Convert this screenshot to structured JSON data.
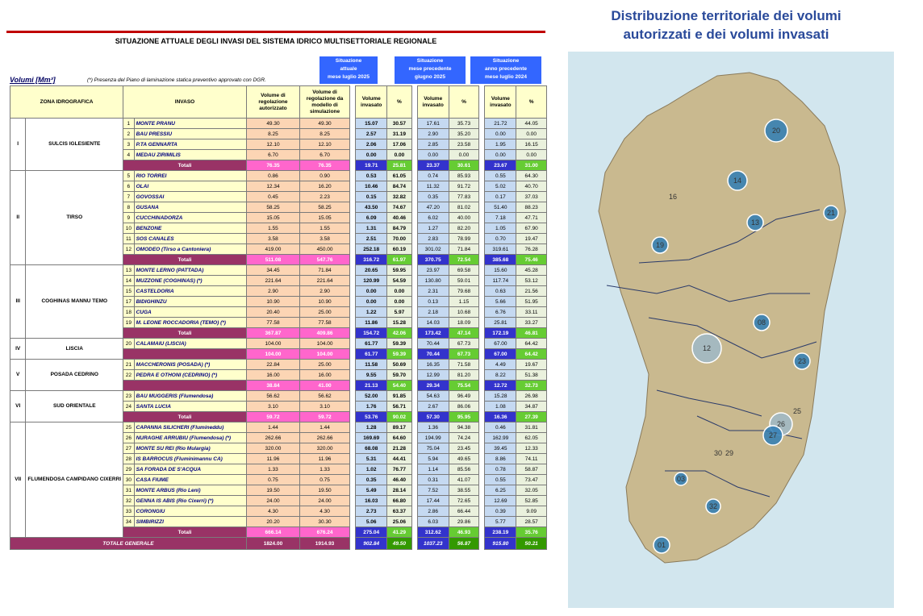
{
  "table": {
    "title": "SITUAZIONE ATTUALE DEGLI INVASI DEL SISTEMA IDRICO MULTISETTORIALE REGIONALE",
    "unit_label": "Volumi [Mm³]",
    "note": "(*) Presenza del Piano di laminazione statica preventivo approvato con DGR.",
    "headers": {
      "zona": "ZONA IDROGRAFICA",
      "invaso": "INVASO",
      "auth": "Volume di regolazione autorizzato",
      "model": "Volume di regolazione da modello di simulazione",
      "vol": "Volume invasato",
      "pct": "%"
    },
    "situations": [
      {
        "line1": "Situazione",
        "line2": "attuale",
        "line3": "mese luglio 2025"
      },
      {
        "line1": "Situazione",
        "line2": "mese precedente",
        "line3": "giugno 2025"
      },
      {
        "line1": "Situazione",
        "line2": "anno precedente",
        "line3": "mese luglio 2024"
      }
    ],
    "zones": [
      {
        "roman": "I",
        "name": "SULCIS IGLESIENTE",
        "rows": [
          {
            "n": "1",
            "name": "MONTE PRANU",
            "auth": "49.30",
            "mod": "49.30",
            "v1": "15.07",
            "p1": "30.57",
            "v2": "17.61",
            "p2": "35.73",
            "v3": "21.72",
            "p3": "44.05"
          },
          {
            "n": "2",
            "name": "BAU PRESSIU",
            "auth": "8.25",
            "mod": "8.25",
            "v1": "2.57",
            "p1": "31.19",
            "v2": "2.90",
            "p2": "35.20",
            "v3": "0.00",
            "p3": "0.00"
          },
          {
            "n": "3",
            "name": "P.TA GENNARTA",
            "auth": "12.10",
            "mod": "12.10",
            "v1": "2.06",
            "p1": "17.06",
            "v2": "2.85",
            "p2": "23.58",
            "v3": "1.95",
            "p3": "16.15"
          },
          {
            "n": "4",
            "name": "MEDAU ZIRIMILIS",
            "auth": "6.70",
            "mod": "6.70",
            "v1": "0.00",
            "p1": "0.00",
            "v2": "0.00",
            "p2": "0.00",
            "v3": "0.00",
            "p3": "0.00"
          }
        ],
        "total": {
          "label": "Totali",
          "auth": "76.35",
          "mod": "76.35",
          "v1": "19.71",
          "p1": "25.81",
          "v2": "23.37",
          "p2": "30.61",
          "v3": "23.67",
          "p3": "31.00"
        }
      },
      {
        "roman": "II",
        "name": "TIRSO",
        "rows": [
          {
            "n": "5",
            "name": "RIO TORREI",
            "auth": "0.86",
            "mod": "0.90",
            "v1": "0.53",
            "p1": "61.05",
            "v2": "0.74",
            "p2": "85.93",
            "v3": "0.55",
            "p3": "64.30"
          },
          {
            "n": "6",
            "name": "OLAI",
            "auth": "12.34",
            "mod": "16.20",
            "v1": "10.46",
            "p1": "84.74",
            "v2": "11.32",
            "p2": "91.72",
            "v3": "5.02",
            "p3": "40.70"
          },
          {
            "n": "7",
            "name": "GOVOSSAI",
            "auth": "0.45",
            "mod": "2.23",
            "v1": "0.15",
            "p1": "32.82",
            "v2": "0.35",
            "p2": "77.83",
            "v3": "0.17",
            "p3": "37.03"
          },
          {
            "n": "8",
            "name": "GUSANA",
            "auth": "58.25",
            "mod": "58.25",
            "v1": "43.50",
            "p1": "74.67",
            "v2": "47.20",
            "p2": "81.02",
            "v3": "51.40",
            "p3": "88.23"
          },
          {
            "n": "9",
            "name": "CUCCHINADORZA",
            "auth": "15.05",
            "mod": "15.05",
            "v1": "6.09",
            "p1": "40.46",
            "v2": "6.02",
            "p2": "40.00",
            "v3": "7.18",
            "p3": "47.71"
          },
          {
            "n": "10",
            "name": "BENZONE",
            "auth": "1.55",
            "mod": "1.55",
            "v1": "1.31",
            "p1": "84.79",
            "v2": "1.27",
            "p2": "82.20",
            "v3": "1.05",
            "p3": "67.90"
          },
          {
            "n": "11",
            "name": "SOS CANALES",
            "auth": "3.58",
            "mod": "3.58",
            "v1": "2.51",
            "p1": "70.00",
            "v2": "2.83",
            "p2": "78.99",
            "v3": "0.70",
            "p3": "19.47"
          },
          {
            "n": "12",
            "name": "OMODEO (Tirso a Cantoniera)",
            "auth": "419.00",
            "mod": "450.00",
            "v1": "252.18",
            "p1": "60.19",
            "v2": "301.02",
            "p2": "71.84",
            "v3": "319.61",
            "p3": "76.28"
          }
        ],
        "total": {
          "label": "Totali",
          "auth": "511.08",
          "mod": "547.76",
          "v1": "316.72",
          "p1": "61.97",
          "v2": "370.75",
          "p2": "72.54",
          "v3": "385.68",
          "p3": "75.46"
        }
      },
      {
        "roman": "III",
        "name": "COGHINAS MANNU TEMO",
        "rows": [
          {
            "n": "13",
            "name": "MONTE LERNO (PATTADA)",
            "auth": "34.45",
            "mod": "71.84",
            "v1": "20.65",
            "p1": "59.95",
            "v2": "23.97",
            "p2": "69.58",
            "v3": "15.60",
            "p3": "45.28"
          },
          {
            "n": "14",
            "name": "MUZZONE (COGHINAS) (*)",
            "auth": "221.64",
            "mod": "221.64",
            "v1": "120.99",
            "p1": "54.59",
            "v2": "130.80",
            "p2": "59.01",
            "v3": "117.74",
            "p3": "53.12"
          },
          {
            "n": "15",
            "name": "CASTELDORIA",
            "auth": "2.90",
            "mod": "2.90",
            "v1": "0.00",
            "p1": "0.00",
            "v2": "2.31",
            "p2": "79.68",
            "v3": "0.63",
            "p3": "21.56"
          },
          {
            "n": "17",
            "name": "BIDIGHINZU",
            "auth": "10.90",
            "mod": "10.90",
            "v1": "0.00",
            "p1": "0.00",
            "v2": "0.13",
            "p2": "1.15",
            "v3": "5.66",
            "p3": "51.95"
          },
          {
            "n": "18",
            "name": "CUGA",
            "auth": "20.40",
            "mod": "25.00",
            "v1": "1.22",
            "p1": "5.97",
            "v2": "2.18",
            "p2": "10.68",
            "v3": "6.76",
            "p3": "33.11"
          },
          {
            "n": "19",
            "name": "M. LEONE ROCCADORIA (TEMO) (*)",
            "auth": "77.58",
            "mod": "77.58",
            "v1": "11.86",
            "p1": "15.28",
            "v2": "14.03",
            "p2": "18.09",
            "v3": "25.81",
            "p3": "33.27"
          }
        ],
        "total": {
          "label": "Totali",
          "auth": "367.87",
          "mod": "409.86",
          "v1": "154.72",
          "p1": "42.06",
          "v2": "173.42",
          "p2": "47.14",
          "v3": "172.19",
          "p3": "46.81"
        }
      },
      {
        "roman": "IV",
        "name": "LISCIA",
        "rows": [
          {
            "n": "20",
            "name": "CALAMAIU (LISCIA)",
            "auth": "104.00",
            "mod": "104.00",
            "v1": "61.77",
            "p1": "59.39",
            "v2": "70.44",
            "p2": "67.73",
            "v3": "67.00",
            "p3": "64.42"
          }
        ],
        "total": {
          "label": "",
          "auth": "104.00",
          "mod": "104.00",
          "v1": "61.77",
          "p1": "59.39",
          "v2": "70.44",
          "p2": "67.73",
          "v3": "67.00",
          "p3": "64.42"
        }
      },
      {
        "roman": "V",
        "name": "POSADA CEDRINO",
        "rows": [
          {
            "n": "21",
            "name": "MACCHERONIS (POSADA) (*)",
            "auth": "22.84",
            "mod": "25.00",
            "v1": "11.58",
            "p1": "50.69",
            "v2": "16.35",
            "p2": "71.58",
            "v3": "4.49",
            "p3": "19.67"
          },
          {
            "n": "22",
            "name": "PEDRA E OTHONI (CEDRINO) (*)",
            "auth": "16.00",
            "mod": "16.00",
            "v1": "9.55",
            "p1": "59.70",
            "v2": "12.99",
            "p2": "81.20",
            "v3": "8.22",
            "p3": "51.38"
          }
        ],
        "total": {
          "label": "",
          "auth": "38.84",
          "mod": "41.00",
          "v1": "21.13",
          "p1": "54.40",
          "v2": "29.34",
          "p2": "75.54",
          "v3": "12.72",
          "p3": "32.73"
        }
      },
      {
        "roman": "VI",
        "name": "SUD ORIENTALE",
        "rows": [
          {
            "n": "23",
            "name": "BAU MUGGERIS (Flumendosa)",
            "auth": "56.62",
            "mod": "56.62",
            "v1": "52.00",
            "p1": "91.85",
            "v2": "54.63",
            "p2": "96.49",
            "v3": "15.28",
            "p3": "26.98"
          },
          {
            "n": "24",
            "name": "SANTA LUCIA",
            "auth": "3.10",
            "mod": "3.10",
            "v1": "1.76",
            "p1": "56.71",
            "v2": "2.67",
            "p2": "86.06",
            "v3": "1.08",
            "p3": "34.87"
          }
        ],
        "total": {
          "label": "Totali",
          "auth": "59.72",
          "mod": "59.72",
          "v1": "53.76",
          "p1": "90.02",
          "v2": "57.30",
          "p2": "95.95",
          "v3": "16.36",
          "p3": "27.39"
        }
      },
      {
        "roman": "VII",
        "name": "FLUMENDOSA CAMPIDANO CIXERRI",
        "rows": [
          {
            "n": "25",
            "name": "CAPANNA SILICHERI (Flumineddu)",
            "auth": "1.44",
            "mod": "1.44",
            "v1": "1.28",
            "p1": "89.17",
            "v2": "1.36",
            "p2": "94.38",
            "v3": "0.46",
            "p3": "31.81"
          },
          {
            "n": "26",
            "name": "NURAGHE ARRUBIU (Flumendosa) (*)",
            "auth": "262.66",
            "mod": "262.66",
            "v1": "169.69",
            "p1": "64.60",
            "v2": "194.99",
            "p2": "74.24",
            "v3": "162.99",
            "p3": "62.05"
          },
          {
            "n": "27",
            "name": "MONTE SU REI (Rio Mulargia)",
            "auth": "320.00",
            "mod": "320.00",
            "v1": "68.08",
            "p1": "21.28",
            "v2": "75.04",
            "p2": "23.45",
            "v3": "39.45",
            "p3": "12.33"
          },
          {
            "n": "28",
            "name": "IS BARROCUS (Fluminimannu CA)",
            "auth": "11.96",
            "mod": "11.96",
            "v1": "5.31",
            "p1": "44.41",
            "v2": "5.94",
            "p2": "49.65",
            "v3": "8.86",
            "p3": "74.11"
          },
          {
            "n": "29",
            "name": "SA FORADA DE S'ACQUA",
            "auth": "1.33",
            "mod": "1.33",
            "v1": "1.02",
            "p1": "76.77",
            "v2": "1.14",
            "p2": "85.56",
            "v3": "0.78",
            "p3": "58.87"
          },
          {
            "n": "30",
            "name": "CASA FIUME",
            "auth": "0.75",
            "mod": "0.75",
            "v1": "0.35",
            "p1": "46.40",
            "v2": "0.31",
            "p2": "41.07",
            "v3": "0.55",
            "p3": "73.47"
          },
          {
            "n": "31",
            "name": "MONTE ARBUS (Rio Leni)",
            "auth": "19.50",
            "mod": "19.50",
            "v1": "5.49",
            "p1": "28.14",
            "v2": "7.52",
            "p2": "38.55",
            "v3": "6.25",
            "p3": "32.05"
          },
          {
            "n": "32",
            "name": "GENNA IS ABIS (Rio Cixerri) (*)",
            "auth": "24.00",
            "mod": "24.00",
            "v1": "16.03",
            "p1": "66.80",
            "v2": "17.44",
            "p2": "72.65",
            "v3": "12.69",
            "p3": "52.85"
          },
          {
            "n": "33",
            "name": "CORONGIU",
            "auth": "4.30",
            "mod": "4.30",
            "v1": "2.73",
            "p1": "63.37",
            "v2": "2.86",
            "p2": "66.44",
            "v3": "0.39",
            "p3": "9.09"
          },
          {
            "n": "34",
            "name": "SIMBIRIZZI",
            "auth": "20.20",
            "mod": "30.30",
            "v1": "5.06",
            "p1": "25.06",
            "v2": "6.03",
            "p2": "29.86",
            "v3": "5.77",
            "p3": "28.57"
          }
        ],
        "total": {
          "label": "Totali",
          "auth": "666.14",
          "mod": "676.24",
          "v1": "275.04",
          "p1": "41.29",
          "v2": "312.62",
          "p2": "46.93",
          "v3": "238.19",
          "p3": "35.76"
        }
      }
    ],
    "grand_total": {
      "label": "TOTALE GENERALE",
      "auth": "1824.00",
      "mod": "1914.93",
      "v1": "902.84",
      "p1": "49.50",
      "v2": "1037.23",
      "p2": "56.87",
      "v3": "915.80",
      "p3": "50.21"
    }
  },
  "map": {
    "title_line1": "Distribuzione territoriale dei volumi",
    "title_line2": "autorizzati e dei volumi invasati",
    "colors": {
      "land": "#c9b98f",
      "sea": "#d2e6ee",
      "marker": "#2f7db5",
      "marker_light": "#9fb9c8"
    },
    "markers": [
      {
        "label": "20"
      },
      {
        "label": "14"
      },
      {
        "label": "16"
      },
      {
        "label": "13"
      },
      {
        "label": "21"
      },
      {
        "label": "19"
      },
      {
        "label": "12"
      },
      {
        "label": "08"
      },
      {
        "label": "23"
      },
      {
        "label": "26"
      },
      {
        "label": "27"
      },
      {
        "label": "30"
      },
      {
        "label": "29"
      },
      {
        "label": "32"
      },
      {
        "label": "01"
      },
      {
        "label": "03"
      },
      {
        "label": "25"
      }
    ]
  }
}
